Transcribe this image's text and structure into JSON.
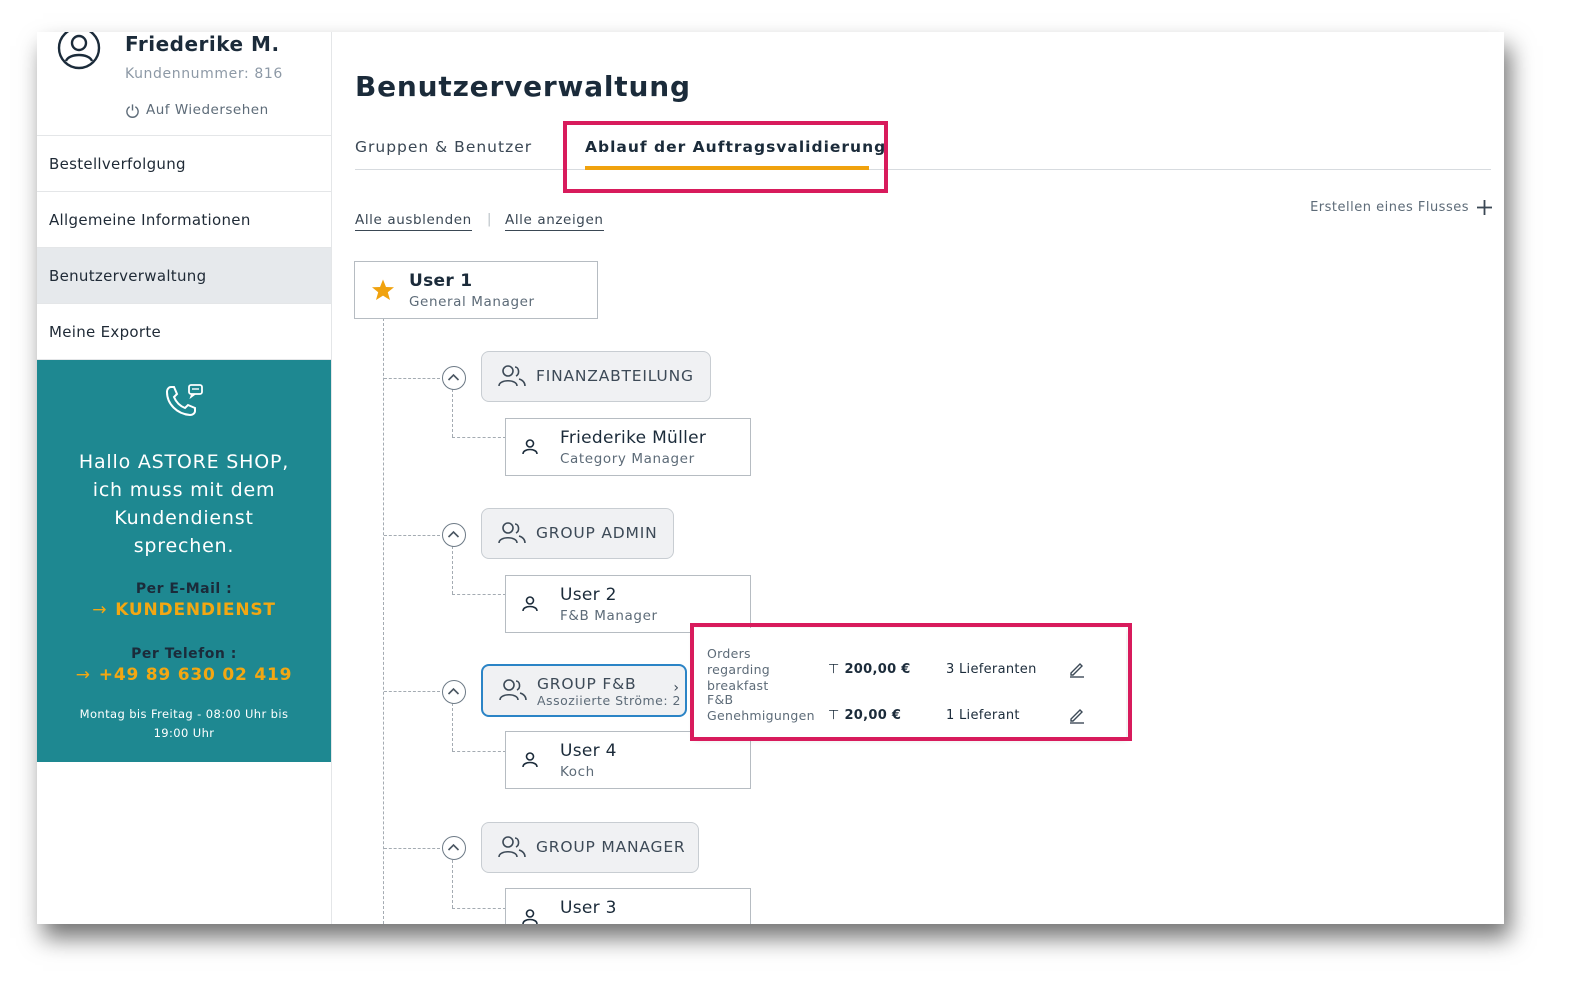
{
  "profile": {
    "name": "Friederike M.",
    "customer_number": "Kundennummer: 816",
    "logout": "Auf Wiedersehen"
  },
  "nav": [
    {
      "label": "Bestellverfolgung"
    },
    {
      "label": "Allgemeine Informationen"
    },
    {
      "label": "Benutzerverwaltung",
      "active": true
    },
    {
      "label": "Meine Exporte"
    }
  ],
  "support": {
    "greeting_lines": [
      "Hallo ASTORE SHOP,",
      "ich muss mit dem",
      "Kundendienst",
      "sprechen."
    ],
    "email_label": "Per E-Mail :",
    "email_link": "KUNDENDIENST",
    "phone_label": "Per Telefon :",
    "phone_number": "+49 89 630 02 419",
    "hours_lines": [
      "Montag bis Freitag - 08:00 Uhr bis",
      "19:00 Uhr"
    ],
    "bg_color": "#1e8891",
    "accent_color": "#f3a712"
  },
  "page": {
    "title": "Benutzerverwaltung",
    "tabs": [
      {
        "label": "Gruppen & Benutzer"
      },
      {
        "label": "Ablauf der Auftragsvalidierung",
        "active": true
      }
    ],
    "collapse_all": "Alle ausblenden",
    "expand_all": "Alle anzeigen",
    "create_flow": "Erstellen eines Flusses"
  },
  "tree": {
    "root": {
      "name": "User 1",
      "role": "General Manager"
    },
    "groups": [
      {
        "label": "FINANZABTEILUNG",
        "members": [
          {
            "name": "Friederike Müller",
            "role": "Category Manager"
          }
        ]
      },
      {
        "label": "GROUP ADMIN",
        "members": [
          {
            "name": "User 2",
            "role": "F&B Manager"
          }
        ]
      },
      {
        "label": "GROUP F&B",
        "sub": "Assoziierte Ströme: 2",
        "members": [
          {
            "name": "User 4",
            "role": "Koch"
          }
        ]
      },
      {
        "label": "GROUP MANAGER",
        "members": [
          {
            "name": "User 3",
            "role": ""
          }
        ]
      }
    ]
  },
  "flows": [
    {
      "name_lines": [
        "Orders",
        "regarding",
        "breakfast"
      ],
      "amount": "200,00 €",
      "suppliers": "3 Lieferanten"
    },
    {
      "name_lines": [
        "F&B",
        "Genehmigungen"
      ],
      "amount": "20,00 €",
      "suppliers": "1 Lieferant"
    }
  ],
  "colors": {
    "highlight": "#d81b5c",
    "tab_accent": "#f0a20e",
    "selected_group_border": "#2b84c6"
  }
}
